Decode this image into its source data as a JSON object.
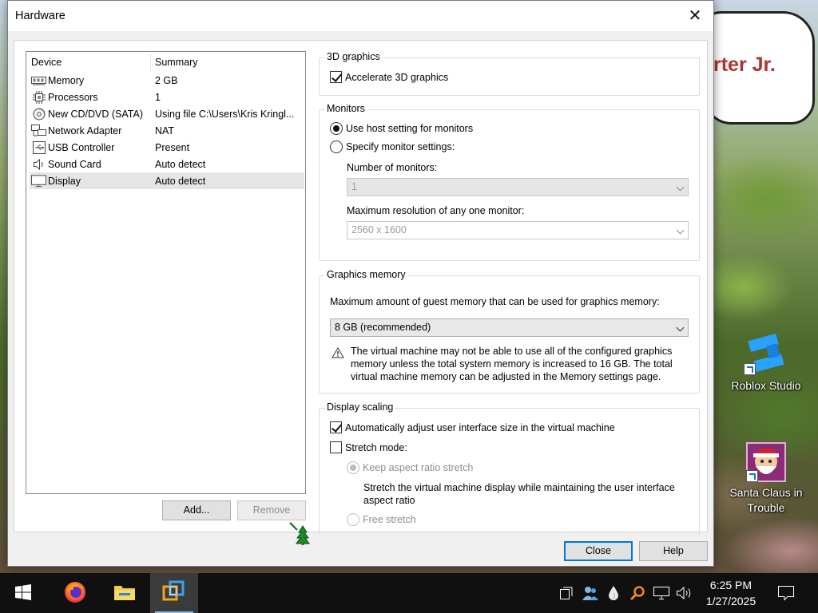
{
  "dialog": {
    "title": "Hardware",
    "close_label": "Close",
    "help_label": "Help"
  },
  "device_list": {
    "col_device": "Device",
    "col_summary": "Summary",
    "rows": [
      {
        "name": "Memory",
        "summary": "2 GB",
        "icon": "memory-icon"
      },
      {
        "name": "Processors",
        "summary": "1",
        "icon": "processor-icon"
      },
      {
        "name": "New CD/DVD (SATA)",
        "summary": "Using file C:\\Users\\Kris Kringl...",
        "icon": "cd-dvd-icon"
      },
      {
        "name": "Network Adapter",
        "summary": "NAT",
        "icon": "network-adapter-icon"
      },
      {
        "name": "USB Controller",
        "summary": "Present",
        "icon": "usb-icon"
      },
      {
        "name": "Sound Card",
        "summary": "Auto detect",
        "icon": "speaker-icon"
      },
      {
        "name": "Display",
        "summary": "Auto detect",
        "icon": "monitor-icon",
        "selected": true
      }
    ],
    "add_label": "Add...",
    "remove_label": "Remove"
  },
  "graphics3d": {
    "legend": "3D graphics",
    "accelerate_label": "Accelerate 3D graphics",
    "accelerate_checked": true
  },
  "monitors": {
    "legend": "Monitors",
    "use_host_label": "Use host setting for monitors",
    "specify_label": "Specify monitor settings:",
    "selected": "use_host",
    "num_monitors_label": "Number of monitors:",
    "num_monitors_value": "1",
    "max_res_label": "Maximum resolution of any one monitor:",
    "max_res_value": "2560 x 1600"
  },
  "graphics_memory": {
    "legend": "Graphics memory",
    "max_label": "Maximum amount of guest memory that can be used for graphics memory:",
    "value": "8 GB (recommended)",
    "warning": "The virtual machine may not be able to use all of the configured graphics memory unless the total system memory is increased to 16 GB. The total virtual machine memory can be adjusted in the Memory settings page."
  },
  "display_scaling": {
    "legend": "Display scaling",
    "auto_adjust_label": "Automatically adjust user interface size in the virtual machine",
    "auto_adjust_checked": true,
    "stretch_label": "Stretch mode:",
    "stretch_checked": false,
    "keep_aspect_label": "Keep aspect ratio stretch",
    "keep_aspect_desc": "Stretch the virtual machine display while maintaining the user interface aspect ratio",
    "free_stretch_label": "Free stretch"
  },
  "desktop": {
    "speech_text": "rter Jr.",
    "icons": [
      {
        "label": "Roblox Studio",
        "icon": "roblox-studio-icon"
      },
      {
        "label": "Santa Claus in Trouble",
        "icon": "santa-claus-game-icon"
      }
    ]
  },
  "taskbar": {
    "apps": [
      {
        "name": "start",
        "icon": "windows-start-icon"
      },
      {
        "name": "firefox",
        "icon": "firefox-icon"
      },
      {
        "name": "file-explorer",
        "icon": "file-explorer-icon"
      },
      {
        "name": "vmware",
        "icon": "vmware-workstation-icon"
      }
    ],
    "time": "6:25 PM",
    "date": "1/27/2025"
  }
}
